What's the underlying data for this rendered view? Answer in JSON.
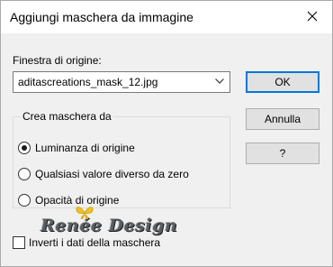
{
  "window": {
    "title": "Aggiungi maschera da immagine",
    "close_icon": "close-icon"
  },
  "source": {
    "label": "Finestra di origine:",
    "selected": "aditascreations_mask_12.jpg",
    "dropdown_icon": "chevron-down-icon"
  },
  "buttons": {
    "ok": "OK",
    "cancel": "Annulla",
    "help": "?"
  },
  "mask_group": {
    "label": "Crea maschera da",
    "options": [
      {
        "label": "Luminanza di origine",
        "checked": true
      },
      {
        "label": "Qualsiasi valore diverso da zero",
        "checked": false
      },
      {
        "label": "Opacità di origine",
        "checked": false
      }
    ]
  },
  "watermark": {
    "text": "Renée Design",
    "icon": "butterfly-icon"
  },
  "invert": {
    "label": "Inverti i dati della maschera",
    "checked": false
  },
  "colors": {
    "accent": "#0078d7",
    "dialog_bg": "#f0f0f0",
    "watermark": "#5a5e60",
    "butterfly": "#f2c21b"
  }
}
